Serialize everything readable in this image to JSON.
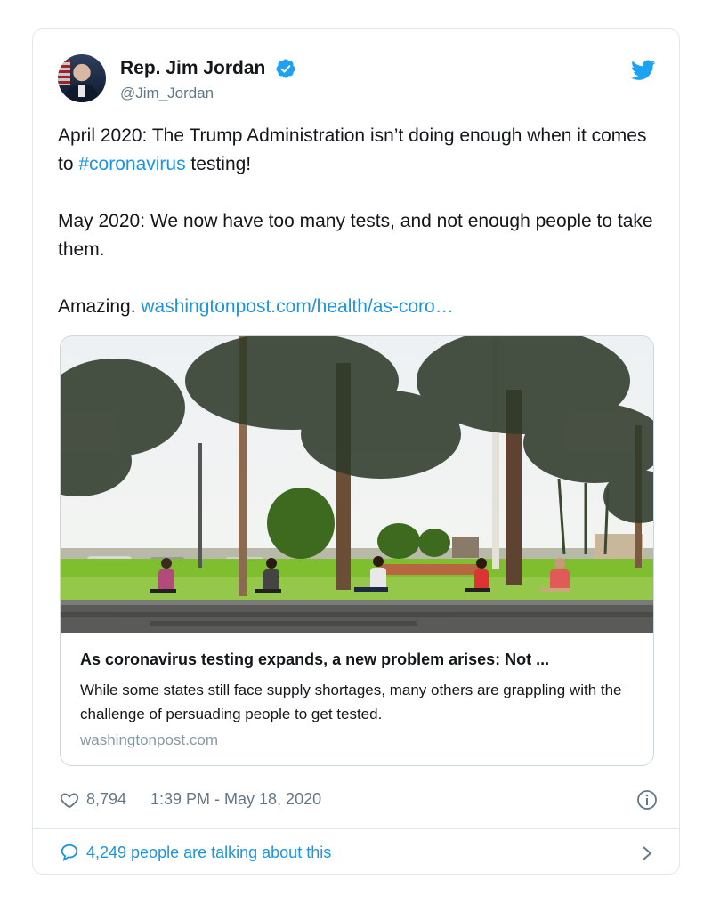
{
  "author": {
    "display_name": "Rep. Jim Jordan",
    "handle": "@Jim_Jordan",
    "verified": true
  },
  "tweet": {
    "para1_before": "April 2020: The Trump Administration isn’t doing enough when it comes to ",
    "hashtag": "#coronavirus",
    "para1_after": " testing!",
    "para2": "May 2020: We now have too many tests, and not enough people to take them.",
    "para3_before": "Amazing. ",
    "link": "washingtonpost.com/health/as-coro…"
  },
  "link_card": {
    "title": "As coronavirus testing expands, a new problem arises: Not ...",
    "description": "While some states still face supply shortages, many others are grappling with the challenge of persuading people to get tested.",
    "domain": "washingtonpost.com"
  },
  "meta": {
    "likes": "8,794",
    "timestamp": "1:39 PM - May 18, 2020"
  },
  "conversation": {
    "label": "4,249 people are talking about this"
  },
  "colors": {
    "link_blue": "#1b95e0",
    "secondary_text": "#657786",
    "border": "#e1e8ed"
  },
  "icons": [
    "verified-badge-icon",
    "twitter-bird-icon",
    "heart-icon",
    "info-icon",
    "speech-bubble-icon",
    "chevron-right-icon"
  ]
}
